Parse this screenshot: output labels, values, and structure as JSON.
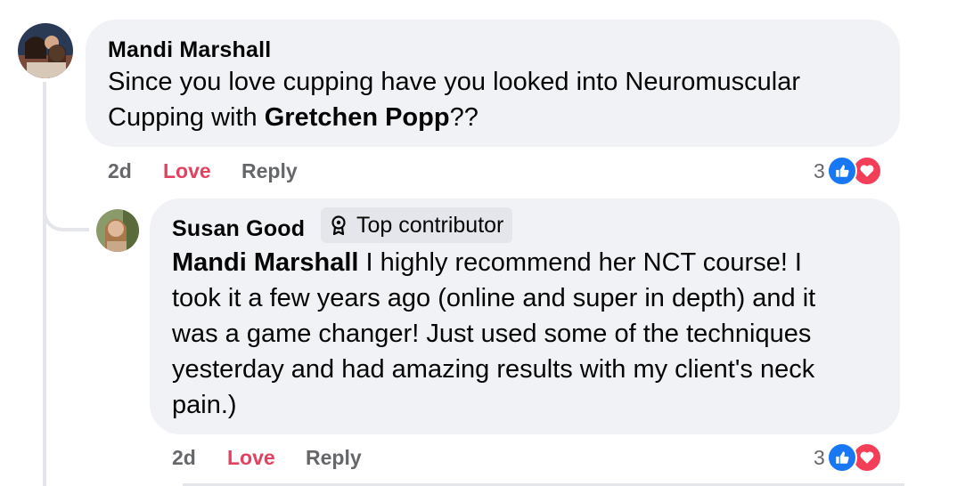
{
  "comment": {
    "author": "Mandi Marshall",
    "text_part1": "Since you love cupping have you looked into Neuromuscular",
    "text_part2": "Cupping with ",
    "mention": "Gretchen Popp",
    "text_part3": "??",
    "time": "2d",
    "reaction_label": "Love",
    "reply_label": "Reply",
    "reaction_count": "3"
  },
  "reply": {
    "author": "Susan Good",
    "badge_label": "Top contributor",
    "mention": "Mandi Marshall",
    "lines": [
      " I highly recommend her NCT course! I",
      "took it a few years ago (online and super in depth) and it",
      "was a game changer! Just used some of the techniques",
      "yesterday and had amazing results with my client's neck",
      "pain.)"
    ],
    "time": "2d",
    "reaction_label": "Love",
    "reply_label": "Reply",
    "reaction_count": "3"
  },
  "icons": {
    "like": "like-icon",
    "love": "heart-icon",
    "badge": "top-contributor-icon"
  },
  "colors": {
    "bubble": "#f0f2f5",
    "love_text": "#e4405f",
    "like_blue": "#1877f2",
    "love_red": "#f33e58",
    "meta_gray": "#65676b"
  }
}
